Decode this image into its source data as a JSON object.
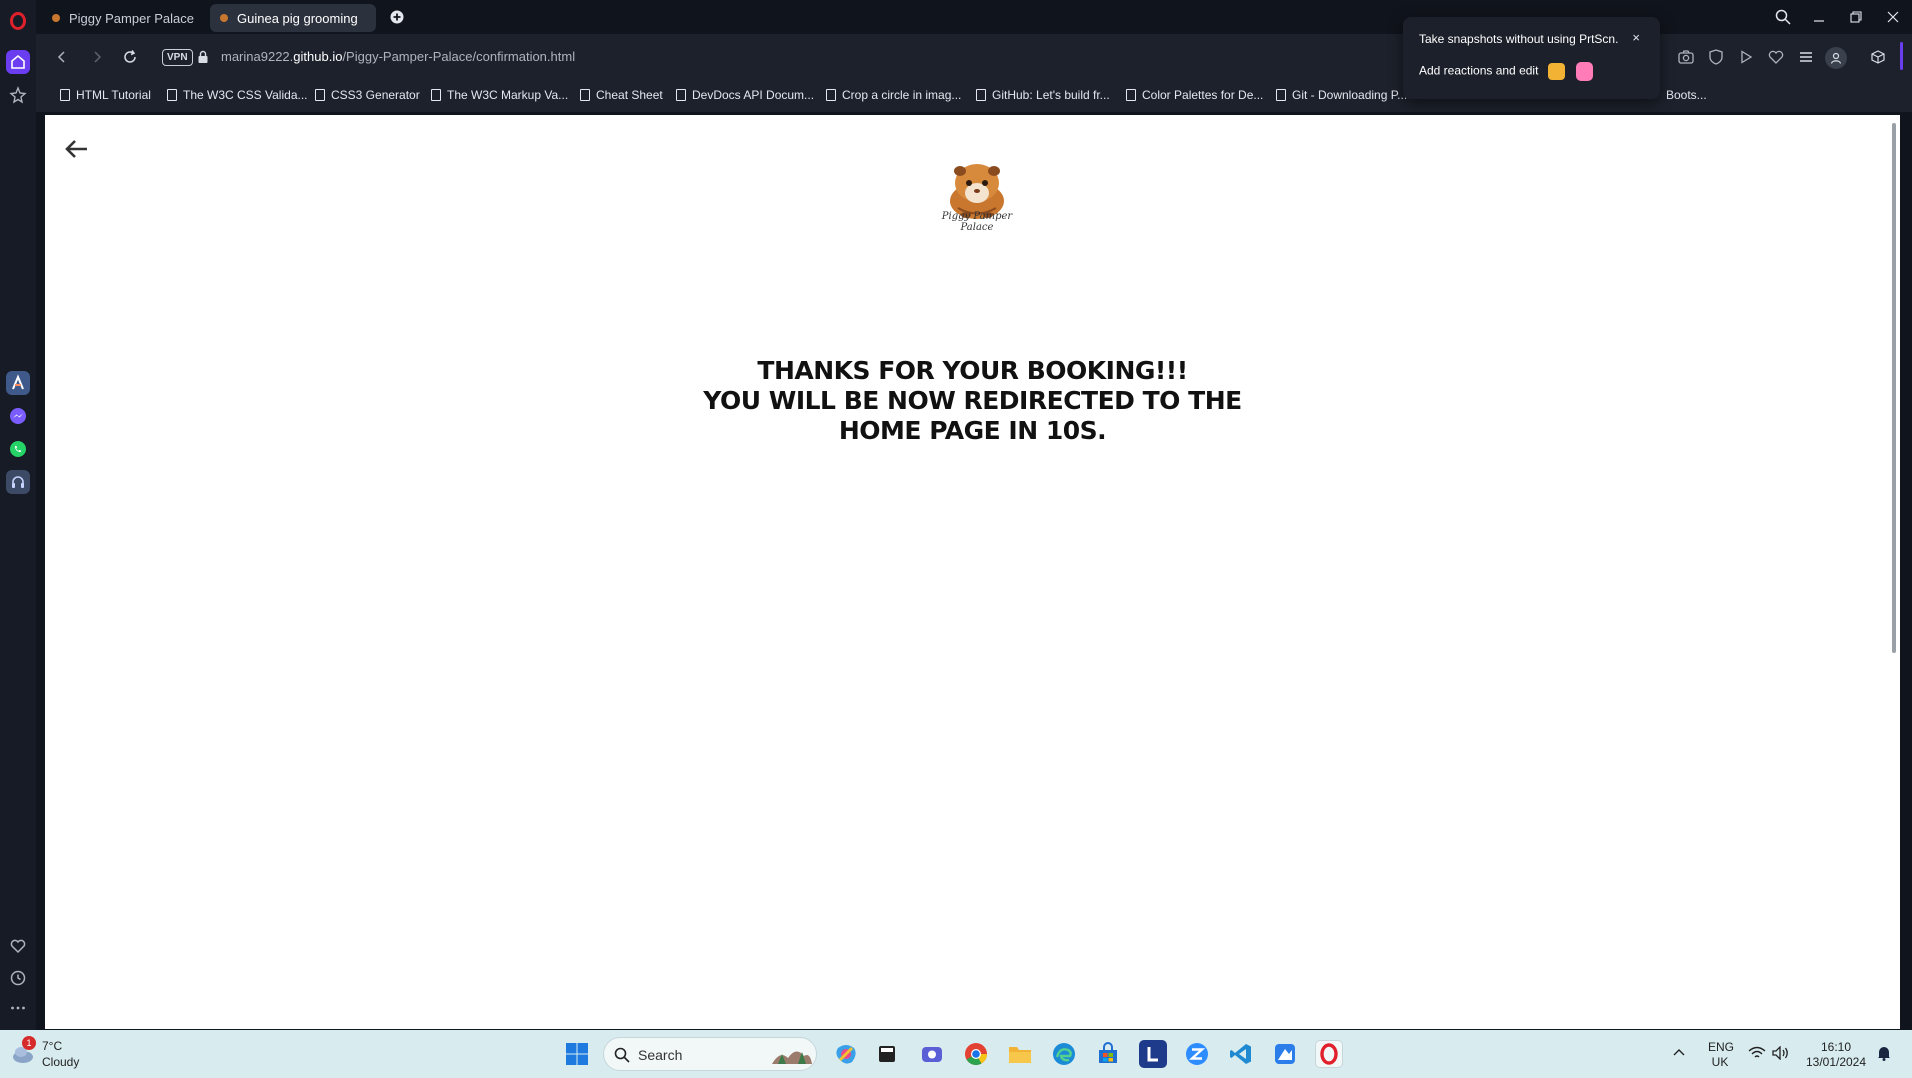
{
  "browser": {
    "tabs": [
      {
        "title": "Piggy Pamper Palace",
        "active": false
      },
      {
        "title": "Guinea pig grooming",
        "active": true
      }
    ],
    "url_prefix": "marina9222.",
    "url_domain": "github.io",
    "url_path": "/Piggy-Pamper-Palace/confirmation.html",
    "vpn_label": "VPN",
    "bookmarks": [
      "HTML Tutorial",
      "The W3C CSS Valida...",
      "CSS3 Generator",
      "The W3C Markup Va...",
      "Cheat Sheet",
      "DevDocs API Docum...",
      "Crop a circle in imag...",
      "GitHub: Let's build fr...",
      "Color Palettes for De...",
      "Git - Downloading P...",
      "Boots..."
    ]
  },
  "popup": {
    "line1": "Take snapshots without using PrtScn.",
    "line2": "Add reactions and edit",
    "close": "×"
  },
  "page": {
    "logo_text_1": "Piggy Pamper",
    "logo_text_2": "Palace",
    "message_line1": "THANKS FOR YOUR BOOKING!!!",
    "message_line2": "YOU WILL BE NOW REDIRECTED TO THE",
    "message_line3": "HOME PAGE IN 10S."
  },
  "taskbar": {
    "weather_temp": "7°C",
    "weather_desc": "Cloudy",
    "weather_badge": "1",
    "search_placeholder": "Search",
    "lang": "ENG",
    "region": "UK",
    "time": "16:10",
    "date": "13/01/2024"
  },
  "colors": {
    "opera_red": "#e0202a",
    "sidebar_active": "#6b3df0",
    "taskbar_bg": "#d8ecf0"
  }
}
